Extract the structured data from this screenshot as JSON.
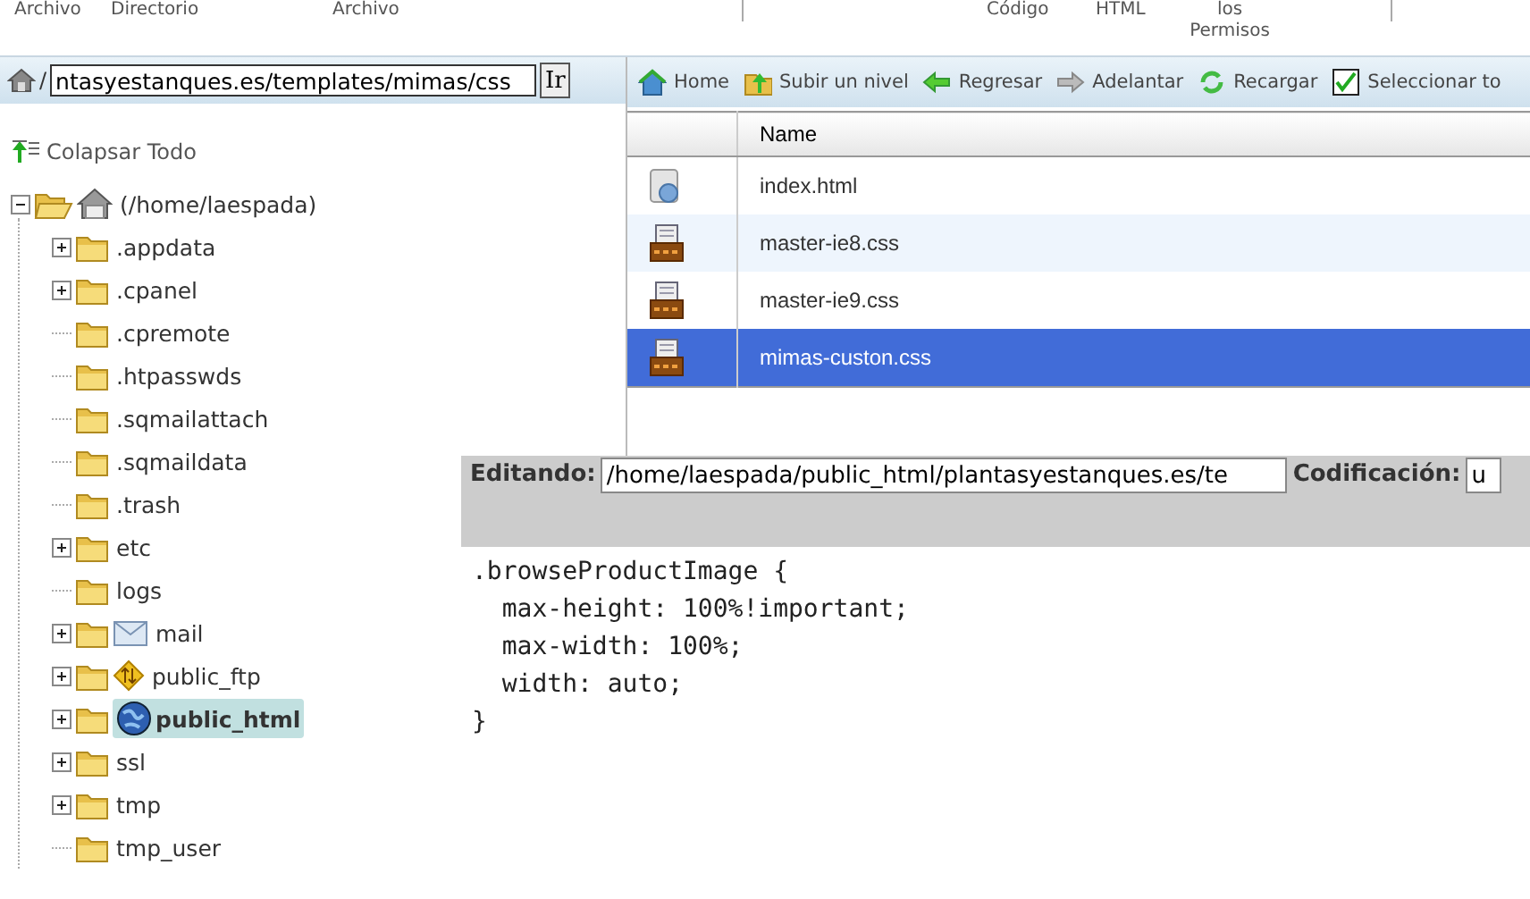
{
  "top_header": {
    "columns": [
      "Archivo",
      "Directorio",
      "Archivo",
      "Código",
      "HTML",
      "los Permisos"
    ]
  },
  "path_bar": {
    "separator": "/",
    "value": "ntasyestanques.es/templates/mimas/css",
    "go_button": "Ir"
  },
  "toolbar": [
    {
      "label": "Home",
      "kind": "home"
    },
    {
      "label": "Subir un nivel",
      "kind": "up"
    },
    {
      "label": "Regresar",
      "kind": "back"
    },
    {
      "label": "Adelantar",
      "kind": "forward"
    },
    {
      "label": "Recargar",
      "kind": "reload"
    },
    {
      "label": "Seleccionar to",
      "kind": "select"
    }
  ],
  "collapse_all": "Colapsar Todo",
  "tree": {
    "label": "(/home/laespada)",
    "expanded": true,
    "children": [
      {
        "label": ".appdata",
        "expandable": true,
        "kind": "folder",
        "selected": false
      },
      {
        "label": ".cpanel",
        "expandable": true,
        "kind": "folder",
        "selected": false
      },
      {
        "label": ".cpremote",
        "expandable": false,
        "kind": "folder",
        "selected": false
      },
      {
        "label": ".htpasswds",
        "expandable": false,
        "kind": "folder",
        "selected": false
      },
      {
        "label": ".sqmailattach",
        "expandable": false,
        "kind": "folder",
        "selected": false
      },
      {
        "label": ".sqmaildata",
        "expandable": false,
        "kind": "folder",
        "selected": false
      },
      {
        "label": ".trash",
        "expandable": false,
        "kind": "folder",
        "selected": false
      },
      {
        "label": "etc",
        "expandable": true,
        "kind": "folder",
        "selected": false
      },
      {
        "label": "logs",
        "expandable": false,
        "kind": "folder",
        "selected": false
      },
      {
        "label": "mail",
        "expandable": true,
        "kind": "mail",
        "selected": false
      },
      {
        "label": "public_ftp",
        "expandable": true,
        "kind": "ftp",
        "selected": false
      },
      {
        "label": "public_html",
        "expandable": true,
        "kind": "web",
        "selected": true
      },
      {
        "label": "ssl",
        "expandable": true,
        "kind": "folder",
        "selected": false
      },
      {
        "label": "tmp",
        "expandable": true,
        "kind": "folder",
        "selected": false
      },
      {
        "label": "tmp_user",
        "expandable": false,
        "kind": "folder",
        "selected": false
      }
    ]
  },
  "file_table": {
    "columns": [
      "Name"
    ],
    "rows": [
      {
        "name": "index.html",
        "kind": "html",
        "selected": false
      },
      {
        "name": "master-ie8.css",
        "kind": "css",
        "selected": false
      },
      {
        "name": "master-ie9.css",
        "kind": "css",
        "selected": false
      },
      {
        "name": "mimas-custon.css",
        "kind": "css",
        "selected": true
      }
    ]
  },
  "editor": {
    "editing_label": "Editando:",
    "path": "/home/laespada/public_html/plantasyestanques.es/te",
    "encoding_label": "Codificación:",
    "encoding": "u",
    "code": [
      ".browseProductImage {",
      "  max-height: 100%!important;",
      "  max-width: 100%;",
      "  width: auto;",
      "}"
    ]
  }
}
